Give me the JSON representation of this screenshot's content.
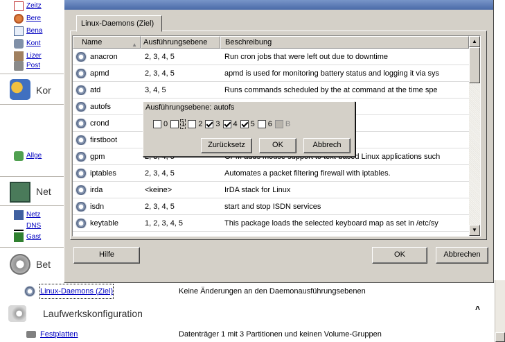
{
  "colors": {
    "link": "#0000c0",
    "titlebar": "#4a6aa8",
    "chrome": "#d4d0c8"
  },
  "background": {
    "sidebar_links": [
      "Zeitz",
      "Bere",
      "Bena",
      "Kont",
      "Lizer",
      "Post"
    ],
    "section_kor": "Kor",
    "link_allge": "Allge",
    "section_net": "Net",
    "net_links": [
      "Netz",
      "DNS",
      "Gast"
    ],
    "section_bet": "Bet",
    "rows": [
      {
        "link": "Linux-Daemons (Ziel)",
        "desc": "Keine Änderungen an den Daemonausführungsebenen"
      },
      {
        "link": "Festplatten",
        "desc": "Datenträger 1 mit 3 Partitionen und keinen Volume-Gruppen"
      }
    ],
    "section_laufwerk": "Laufwerkskonfiguration",
    "collapse_glyph": "˄"
  },
  "dialog": {
    "tab_label": "Linux-Daemons (Ziel)",
    "columns": [
      "Name",
      "Ausführungsebene",
      "Beschreibung"
    ],
    "services": [
      {
        "name": "anacron",
        "levels": "2, 3, 4, 5",
        "desc": "Run cron jobs that were left out due to downtime"
      },
      {
        "name": "apmd",
        "levels": "2, 3, 4, 5",
        "desc": "apmd is used for monitoring battery status and logging it via  sys"
      },
      {
        "name": "atd",
        "levels": "3, 4, 5",
        "desc": "Runs commands scheduled by the at command at the time  spe"
      },
      {
        "name": "autofs",
        "levels": "",
        "desc": ""
      },
      {
        "name": "crond",
        "levels": "",
        "desc": "at runs user-specified  progr"
      },
      {
        "name": "firstboot",
        "levels": "",
        "desc": "t runs on the first time /"
      },
      {
        "name": "gpm",
        "levels": "2, 3, 4, 5",
        "desc": "GPM adds mouse support to text-based Linux applications such"
      },
      {
        "name": "iptables",
        "levels": "2, 3, 4, 5",
        "desc": "Automates a packet filtering firewall with iptables."
      },
      {
        "name": "irda",
        "levels": "<keine>",
        "desc": "IrDA stack for Linux"
      },
      {
        "name": "isdn",
        "levels": "2, 3, 4, 5",
        "desc": "start and stop ISDN services"
      },
      {
        "name": "keytable",
        "levels": "1, 2, 3, 4, 5",
        "desc": "This package loads the selected keyboard map as set in  /etc/sy"
      }
    ],
    "popup": {
      "title": "Ausführungsebene: autofs",
      "checks": [
        {
          "label": "0",
          "checked": false
        },
        {
          "label": "1",
          "checked": false
        },
        {
          "label": "2",
          "checked": false
        },
        {
          "label": "3",
          "checked": true
        },
        {
          "label": "4",
          "checked": true
        },
        {
          "label": "5",
          "checked": true
        },
        {
          "label": "6",
          "checked": false
        },
        {
          "label": "B",
          "checked": false,
          "disabled": true
        }
      ],
      "reset_label": "Zurücksetz",
      "ok_label": "OK",
      "cancel_label": "Abbrech"
    },
    "help_label": "Hilfe",
    "ok_label": "OK",
    "cancel_label": "Abbrechen"
  }
}
